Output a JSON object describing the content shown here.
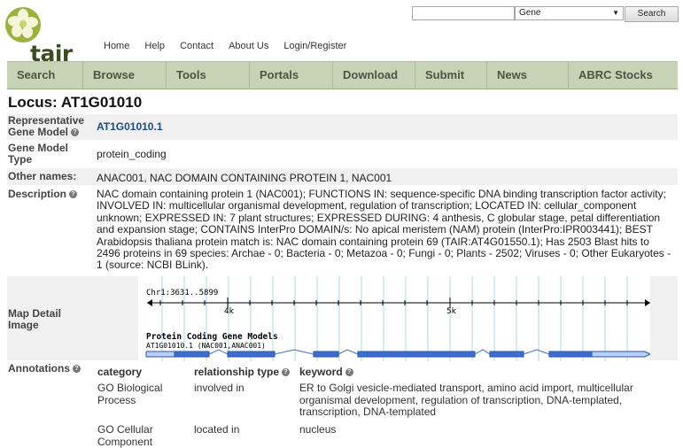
{
  "header": {
    "logo_text": "tair",
    "top_nav": [
      "Home",
      "Help",
      "Contact",
      "About Us",
      "Login/Register"
    ],
    "search_placeholder": "",
    "search_select_value": "Gene",
    "search_button": "Search"
  },
  "main_nav": [
    {
      "label": "Search",
      "w": 86
    },
    {
      "label": "Browse",
      "w": 94
    },
    {
      "label": "Tools",
      "w": 94
    },
    {
      "label": "Portals",
      "w": 94
    },
    {
      "label": "Download",
      "w": 93
    },
    {
      "label": "Submit",
      "w": 81
    },
    {
      "label": "News",
      "w": 92
    },
    {
      "label": "ABRC Stocks",
      "w": 123
    }
  ],
  "locus": {
    "title": "Locus: AT1G01010",
    "rep_model_label": "Representative Gene Model",
    "rep_model_value": "AT1G01010.1",
    "gene_model_type_label": "Gene Model Type",
    "gene_model_type_value": "protein_coding",
    "other_names_label": "Other names:",
    "other_names_value": "ANAC001, NAC DOMAIN CONTAINING PROTEIN 1, NAC001",
    "description_label": "Description",
    "description_lines": [
      "NAC domain containing protein 1 (NAC001); FUNCTIONS IN: sequence-specific DNA binding transcription factor activity;",
      "INVOLVED IN: multicellular organismal development, regulation of transcription; LOCATED IN: cellular_component",
      "unknown; EXPRESSED IN: 7 plant structures; EXPRESSED DURING: 4 anthesis, C globular stage, petal differentiation",
      "and expansion stage; CONTAINS InterPro DOMAIN/s: No apical meristem (NAM) protein (InterPro:IPR003441); BEST",
      "Arabidopsis thaliana protein match is: NAC domain containing protein 69 (TAIR:AT4G01550.1); Has 2503 Blast hits to",
      "2496 proteins in 69 species: Archae - 0; Bacteria - 0; Metazoa - 0; Fungi - 0; Plants - 2502; Viruses - 0; Other Eukaryotes -",
      "1 (source: NCBI BLink)."
    ],
    "map_label": "Map Detail Image",
    "annotations_label": "Annotations"
  },
  "map": {
    "range_label": "Chr1:3631..5899",
    "tick_4k": "4k",
    "tick_5k": "5k",
    "track_title": "Protein Coding Gene Models",
    "model_label": "AT1G01010.1 (NAC001,ANAC001)",
    "colors": {
      "exon": "#3a6fcf",
      "utr": "#b8d0f4",
      "grid": "#9fd7e3"
    }
  },
  "annotations": {
    "headers": [
      "category",
      "relationship type",
      "keyword"
    ],
    "rows": [
      {
        "category_lines": [
          "GO Biological",
          "Process"
        ],
        "relationship": "involved in",
        "keyword_lines": [
          "ER to Golgi vesicle-mediated transport, amino acid import, multicellular",
          "organismal development, regulation of transcription, DNA-templated,",
          "transcription, DNA-templated"
        ]
      },
      {
        "category_lines": [
          "GO Cellular",
          "Component"
        ],
        "relationship": "located in",
        "keyword_lines": [
          "nucleus"
        ]
      }
    ]
  }
}
